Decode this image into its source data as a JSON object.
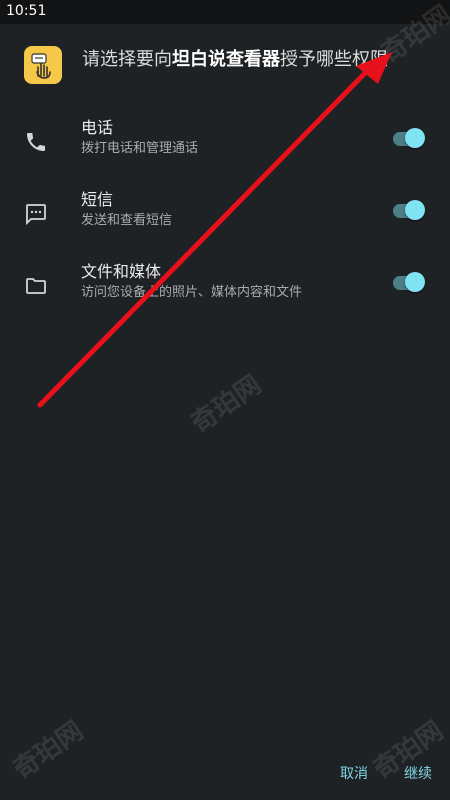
{
  "status_bar": {
    "time": "10:51"
  },
  "header": {
    "title_prefix": "请选择要向",
    "app_name": "坦白说查看器",
    "title_suffix": "授予哪些权限"
  },
  "permissions": [
    {
      "title": "电话",
      "description": "拨打电话和管理通话",
      "icon": "phone-icon",
      "enabled": true
    },
    {
      "title": "短信",
      "description": "发送和查看短信",
      "icon": "message-icon",
      "enabled": true
    },
    {
      "title": "文件和媒体",
      "description": "访问您设备上的照片、媒体内容和文件",
      "icon": "folder-icon",
      "enabled": true
    }
  ],
  "footer": {
    "cancel_label": "取消",
    "continue_label": "继续"
  },
  "watermark_text": "奇珀网",
  "colors": {
    "background": "#1f2224",
    "accent": "#7fd6e6",
    "toggle_thumb": "#7fe3f2",
    "app_icon_bg": "#f6c84a",
    "annotation_arrow": "#e8101a"
  }
}
